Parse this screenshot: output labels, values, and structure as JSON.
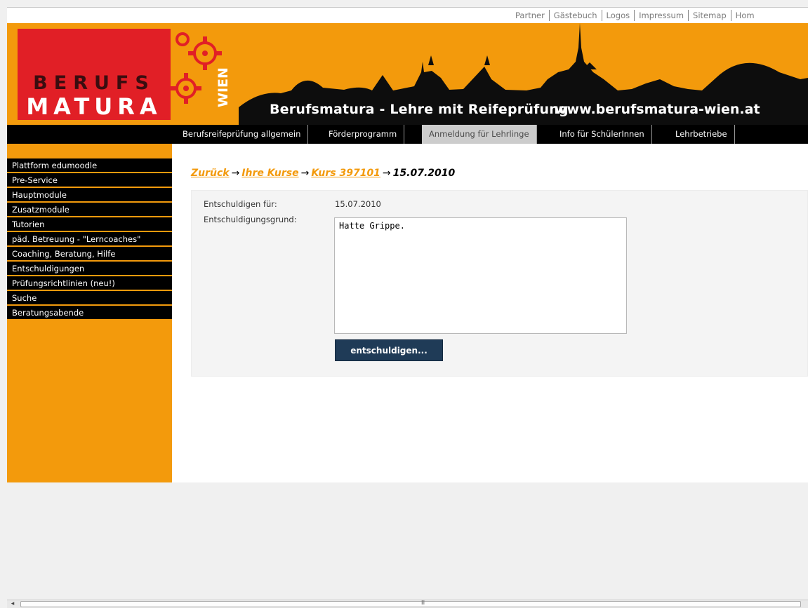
{
  "toplinks": [
    "Partner",
    "Gästebuch",
    "Logos",
    "Impressum",
    "Sitemap",
    "Hom"
  ],
  "banner": {
    "logo_line1": "BERUFS",
    "logo_line2": "MATURA",
    "wien": "WIEN",
    "slogan": "Berufsmatura - Lehre mit Reifeprüfung",
    "url": "www.berufsmatura-wien.at"
  },
  "topnav": [
    {
      "label": "Berufsreifeprüfung allgemein",
      "active": false
    },
    {
      "label": "Förderprogramm",
      "active": false
    },
    {
      "label": "Anmeldung für Lehrlinge",
      "active": true
    },
    {
      "label": "Info für SchülerInnen",
      "active": false
    },
    {
      "label": "Lehrbetriebe",
      "active": false
    }
  ],
  "sidebar": [
    "Plattform edumoodle",
    "Pre-Service",
    "Hauptmodule",
    "Zusatzmodule",
    "Tutorien",
    "päd. Betreuung - \"Lerncoaches\"",
    "Coaching, Beratung, Hilfe",
    "Entschuldigungen",
    "Prüfungsrichtlinien (neu!)",
    "Suche",
    "Beratungsabende"
  ],
  "breadcrumb": {
    "back": "Zurück",
    "courses": "Ihre Kurse",
    "course": "Kurs 397101",
    "current": "15.07.2010",
    "arrow": "→"
  },
  "form": {
    "label_for": "Entschuldigen für:",
    "value_for": "15.07.2010",
    "label_reason": "Entschuldigungsgrund:",
    "reason_text": "Hatte Grippe.",
    "submit_label": "entschuldigen..."
  },
  "scrollbar": {
    "grip": "III"
  },
  "colors": {
    "orange": "#f39a0c",
    "red": "#e11f26",
    "navy_button": "#1f3b57"
  }
}
